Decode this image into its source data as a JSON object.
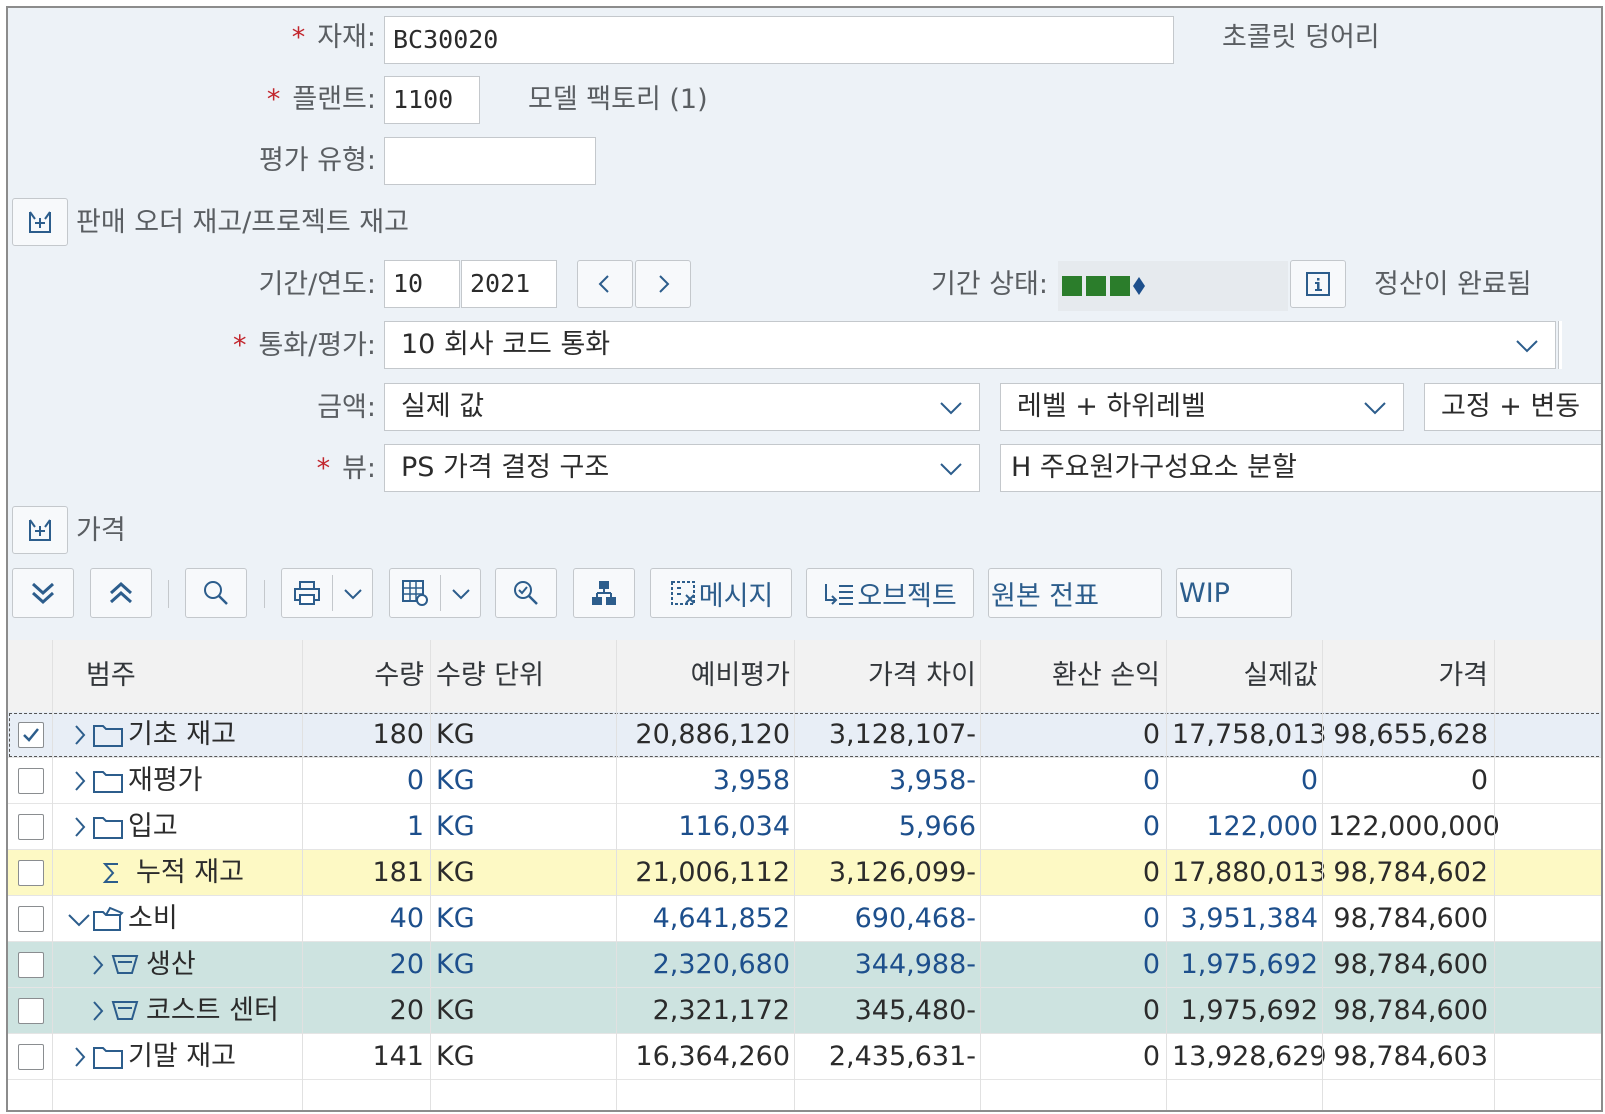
{
  "header": {
    "material_label": "자재:",
    "material_value": "BC30020",
    "material_desc": "초콜릿 덩어리",
    "plant_label": "플랜트:",
    "plant_value": "1100",
    "plant_desc": "모델 팩토리 (1)",
    "valuation_type_label": "평가 유형:",
    "valuation_type_value": "",
    "sales_order_stock_label": "판매 오더 재고/프로젝트 재고",
    "period_year_label": "기간/연도:",
    "period_value": "10",
    "year_value": "2021",
    "period_status_label": "기간 상태:",
    "period_status_text": "정산이 완료됨",
    "currency_label": "통화/평가:",
    "currency_value": "10 회사 코드 통화",
    "amount_label": "금액:",
    "amount_value": "실제 값",
    "level_value": "레벨 + 하위레벨",
    "fixed_var_value": "고정 + 변동",
    "view_label": "뷰:",
    "view_value": "PS 가격 결정 구조",
    "cost_component_value": "H 주요원가구성요소 분할",
    "price_section_label": "가격"
  },
  "toolbar": {
    "message_label": "메시지",
    "object_label": "오브젝트",
    "source_doc_label": "원본 전표",
    "wip_label": "WIP"
  },
  "table": {
    "columns": [
      "범주",
      "수량",
      "수량 단위",
      "예비평가",
      "가격 차이",
      "환산 손익",
      "실제값",
      "가격"
    ],
    "rows": [
      {
        "category": "기초 재고",
        "qty": "180",
        "unit": "KG",
        "prelim": "20,886,120",
        "price_diff": "3,128,107-",
        "exch": "0",
        "actual": "17,758,013",
        "price": "98,655,628",
        "checked": true
      },
      {
        "category": "재평가",
        "qty": "0",
        "unit": "KG",
        "prelim": "3,958",
        "price_diff": "3,958-",
        "exch": "0",
        "actual": "0",
        "price": "0",
        "checked": false
      },
      {
        "category": "입고",
        "qty": "1",
        "unit": "KG",
        "prelim": "116,034",
        "price_diff": "5,966",
        "exch": "0",
        "actual": "122,000",
        "price": "122,000,000",
        "checked": false
      },
      {
        "category": "누적 재고",
        "qty": "181",
        "unit": "KG",
        "prelim": "21,006,112",
        "price_diff": "3,126,099-",
        "exch": "0",
        "actual": "17,880,013",
        "price": "98,784,602",
        "checked": false
      },
      {
        "category": "소비",
        "qty": "40",
        "unit": "KG",
        "prelim": "4,641,852",
        "price_diff": "690,468-",
        "exch": "0",
        "actual": "3,951,384",
        "price": "98,784,600",
        "checked": false
      },
      {
        "category": "생산",
        "qty": "20",
        "unit": "KG",
        "prelim": "2,320,680",
        "price_diff": "344,988-",
        "exch": "0",
        "actual": "1,975,692",
        "price": "98,784,600",
        "checked": false
      },
      {
        "category": "코스트 센터",
        "qty": "20",
        "unit": "KG",
        "prelim": "2,321,172",
        "price_diff": "345,480-",
        "exch": "0",
        "actual": "1,975,692",
        "price": "98,784,600",
        "checked": false
      },
      {
        "category": "기말 재고",
        "qty": "141",
        "unit": "KG",
        "prelim": "16,364,260",
        "price_diff": "2,435,631-",
        "exch": "0",
        "actual": "13,928,629",
        "price": "98,784,603",
        "checked": false
      }
    ]
  },
  "colors": {
    "required": "#c2262d",
    "status_green": "#2b7d2b",
    "status_blue": "#1d4f8c",
    "link_blue": "#1d4f8c",
    "selected_row": "#e8eef6",
    "sum_row": "#fdf9c4",
    "child_row": "#cde3e0"
  }
}
